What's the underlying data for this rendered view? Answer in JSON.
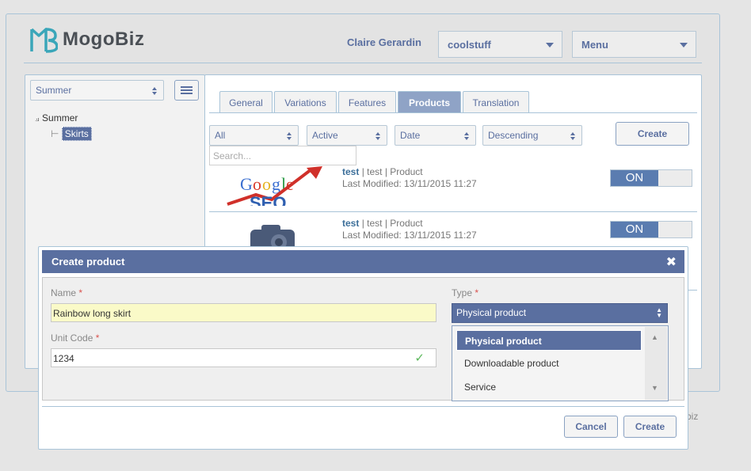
{
  "app": {
    "brand": "MogoBiz"
  },
  "header": {
    "user_name": "Claire Gerardin",
    "store_select": "coolstuff",
    "menu_select": "Menu"
  },
  "sidebar": {
    "catalog_select": "Summer",
    "tree": {
      "root": "Summer",
      "child": "Skirts"
    }
  },
  "tabs": [
    {
      "label": "General"
    },
    {
      "label": "Variations"
    },
    {
      "label": "Features"
    },
    {
      "label": "Products",
      "active": true
    },
    {
      "label": "Translation"
    }
  ],
  "filters": {
    "type": "All",
    "status": "Active",
    "sort_field": "Date",
    "sort_order": "Descending",
    "create_label": "Create",
    "search_placeholder": "Search..."
  },
  "products": [
    {
      "name": "test",
      "tag": "test",
      "kind": "Product",
      "modified": "Last Modified: 13/11/2015 11:27",
      "toggle": "ON",
      "image": "seo-image"
    },
    {
      "name": "test",
      "tag": "test",
      "kind": "Product",
      "modified": "Last Modified: 13/11/2015 11:27",
      "toggle": "ON",
      "image": "camera-image"
    }
  ],
  "footer": {
    "text": "biz"
  },
  "modal": {
    "title": "Create product",
    "name_label": "Name",
    "name_value": "Rainbow long skirt",
    "unit_code_label": "Unit Code",
    "unit_code_value": "1234",
    "type_label": "Type",
    "type_value": "Physical product",
    "type_options": [
      "Physical product",
      "Downloadable product",
      "Service"
    ],
    "required_mark": "*",
    "cancel_label": "Cancel",
    "create_label": "Create"
  },
  "colors": {
    "accent": "#5a6fa0",
    "toggle_on": "#5a7cb0",
    "required": "#d9534f",
    "highlight_input": "#fafac8"
  }
}
